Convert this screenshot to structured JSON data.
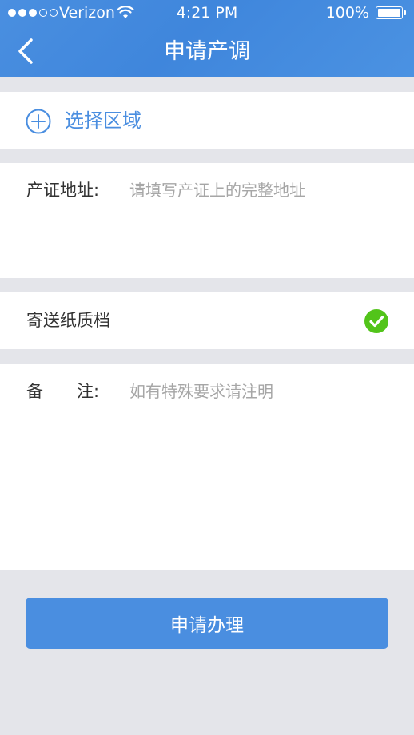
{
  "status_bar": {
    "carrier": "Verizon",
    "time": "4:21 PM",
    "battery": "100%",
    "signal_filled": 3,
    "signal_total": 5
  },
  "nav": {
    "title": "申请产调",
    "back_icon": "chevron-left-icon"
  },
  "region": {
    "label": "选择区域",
    "icon": "plus-circle-icon"
  },
  "address": {
    "label": "产证地址:",
    "value": "",
    "placeholder": "请填写产证上的完整地址"
  },
  "paper": {
    "label": "寄送纸质档",
    "checked": true,
    "icon": "check-circle-icon",
    "check_color": "#52c41a"
  },
  "remark": {
    "label": "备　　注:",
    "value": "",
    "placeholder": "如有特殊要求请注明"
  },
  "submit": {
    "label": "申请办理"
  },
  "colors": {
    "accent": "#4a8ee0",
    "background": "#e4e5ea"
  }
}
